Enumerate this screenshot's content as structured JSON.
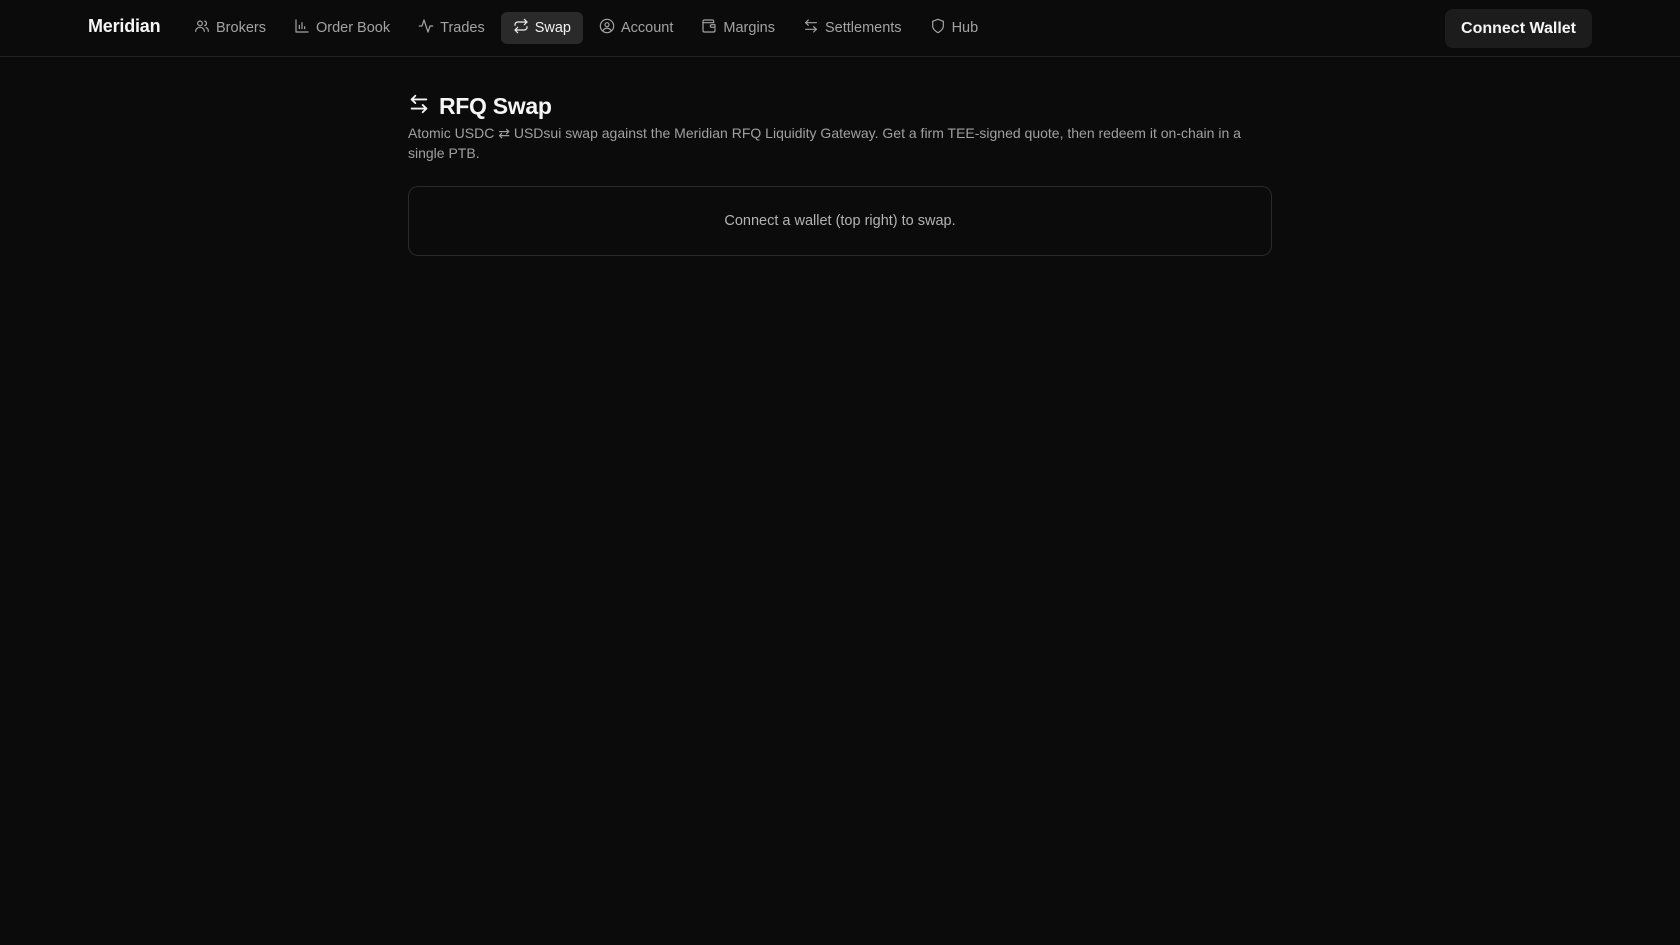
{
  "header": {
    "brand": "Meridian",
    "nav": [
      {
        "label": "Brokers",
        "icon": "users-icon",
        "active": false
      },
      {
        "label": "Order Book",
        "icon": "bar-chart-icon",
        "active": false
      },
      {
        "label": "Trades",
        "icon": "activity-icon",
        "active": false
      },
      {
        "label": "Swap",
        "icon": "repeat-icon",
        "active": true
      },
      {
        "label": "Account",
        "icon": "user-circle-icon",
        "active": false
      },
      {
        "label": "Margins",
        "icon": "wallet-icon",
        "active": false
      },
      {
        "label": "Settlements",
        "icon": "arrow-left-right-icon",
        "active": false
      },
      {
        "label": "Hub",
        "icon": "shield-icon",
        "active": false
      }
    ],
    "connect_label": "Connect Wallet"
  },
  "main": {
    "title": "RFQ Swap",
    "title_icon": "arrow-left-right-icon",
    "description": "Atomic USDC ⇄ USDsui swap against the Meridian RFQ Liquidity Gateway. Get a firm TEE-signed quote, then redeem it on-chain in a single PTB.",
    "notice": "Connect a wallet (top right) to swap."
  },
  "colors": {
    "background": "#0b0b0b",
    "active_nav_bg": "#2a2a2a",
    "button_bg": "#1c1c1c",
    "border": "#2a2a2a"
  }
}
